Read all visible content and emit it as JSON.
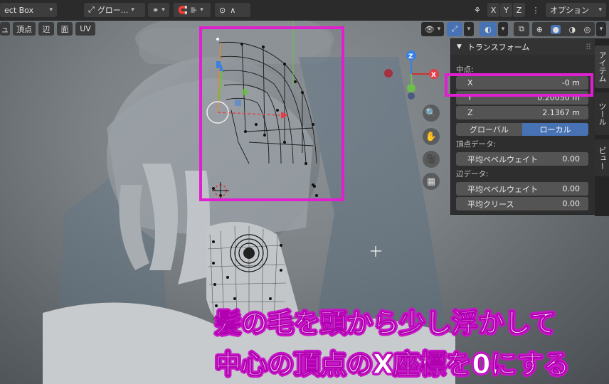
{
  "header": {
    "select_mode": "ect Box",
    "transform_orientation": "グロー...",
    "options_label": "オプション",
    "mirror_axes": [
      "X",
      "Y",
      "Z"
    ]
  },
  "mode_bar": {
    "items": [
      "ュ",
      "頂点",
      "辺",
      "面",
      "UV"
    ]
  },
  "n_panel": {
    "section_title": "トランスフォーム",
    "median_label": "中点:",
    "x_label": "X",
    "x_value": "-0 m",
    "y_value": "0.20050 m",
    "z_label": "Z",
    "z_value": "2.1367 m",
    "global_label": "グローバル",
    "local_label": "ローカル",
    "vertex_data_label": "頂点データ:",
    "vertex_bevel_label": "平均ベベルウェイト",
    "vertex_bevel_value": "0.00",
    "edge_data_label": "辺データ:",
    "edge_bevel_label": "平均ベベルウェイト",
    "edge_bevel_value": "0.00",
    "edge_crease_label": "平均クリース",
    "edge_crease_value": "0.00"
  },
  "side_tabs": [
    "アイテム",
    "ツール",
    "ビュー"
  ],
  "caption": {
    "line1": "髪の毛を頭から少し浮かして",
    "line2": "中心の頂点のX座標を0にする"
  },
  "colors": {
    "highlight": "#e020d0",
    "active_toggle": "#4772b3",
    "axis_x": "#e04050",
    "axis_y": "#80c030",
    "axis_z": "#3a80e0"
  },
  "icons": [
    "move-gizmo-icon",
    "zoom-icon",
    "hand-pan-icon",
    "camera-icon",
    "grid-icon",
    "snap-icon",
    "proportional-icon",
    "xray-icon",
    "shading-icons"
  ]
}
